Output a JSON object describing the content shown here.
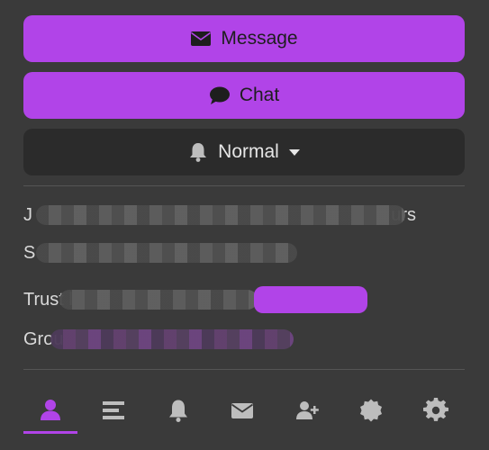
{
  "buttons": {
    "message_label": "Message",
    "chat_label": "Chat",
    "notification_label": "Normal"
  },
  "info": {
    "joined_prefix": "J",
    "joined_suffix": "urs",
    "seen_prefix": "S",
    "trust_prefix": "Trust l",
    "group_prefix": "Grou"
  },
  "icons": {
    "message": "envelope-icon",
    "chat": "speech-bubble-icon",
    "notification": "bell-icon",
    "caret": "caret-down-icon"
  },
  "nav": {
    "items": [
      {
        "name": "profile-tab",
        "icon": "user-icon",
        "active": true
      },
      {
        "name": "activity-tab",
        "icon": "list-icon",
        "active": false
      },
      {
        "name": "notifications-tab",
        "icon": "bell-icon",
        "active": false
      },
      {
        "name": "messages-tab",
        "icon": "envelope-icon",
        "active": false
      },
      {
        "name": "follow-tab",
        "icon": "user-plus-icon",
        "active": false
      },
      {
        "name": "badges-tab",
        "icon": "badge-icon",
        "active": false
      },
      {
        "name": "settings-tab",
        "icon": "gear-icon",
        "active": false
      }
    ]
  },
  "colors": {
    "accent": "#b144e8",
    "background": "#3a3a3a",
    "dark_button": "#2b2b2b",
    "icon_gray": "#bdbdbd"
  }
}
